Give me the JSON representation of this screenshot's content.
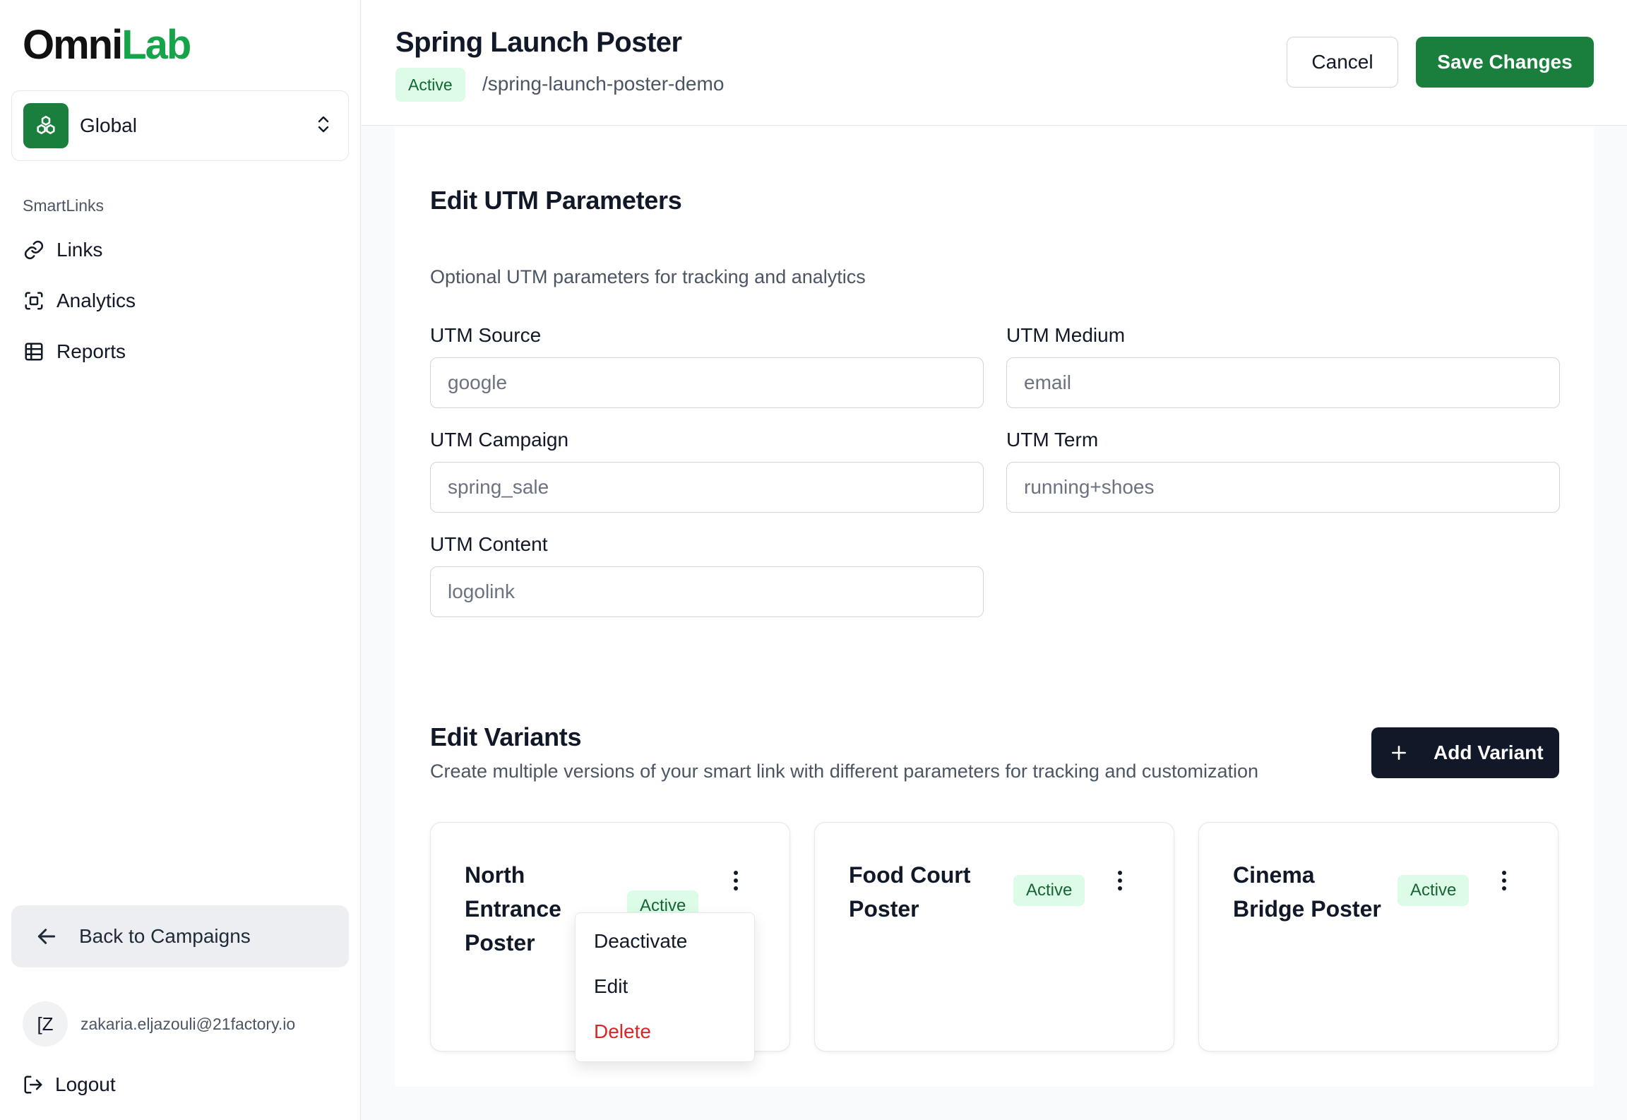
{
  "brand": {
    "logo_part1": "Omni",
    "logo_part2": "Lab",
    "accent": "#16a34a",
    "primary": "#1a7f3c"
  },
  "sidebar": {
    "org": {
      "name": "Global",
      "icon": "cluster-icon"
    },
    "section_label": "SmartLinks",
    "items": [
      {
        "label": "Links",
        "icon": "link-icon"
      },
      {
        "label": "Analytics",
        "icon": "scan-icon"
      },
      {
        "label": "Reports",
        "icon": "table-icon"
      }
    ],
    "back_label": "Back to Campaigns",
    "user": {
      "initials": "[Z",
      "email": "zakaria.eljazouli@21factory.io"
    },
    "logout_label": "Logout"
  },
  "header": {
    "title": "Spring Launch Poster",
    "status": "Active",
    "slug": "/spring-launch-poster-demo",
    "cancel_label": "Cancel",
    "save_label": "Save Changes"
  },
  "utm": {
    "title": "Edit UTM Parameters",
    "description": "Optional UTM parameters for tracking and analytics",
    "fields": [
      {
        "label": "UTM Source",
        "placeholder": "google",
        "value": ""
      },
      {
        "label": "UTM Medium",
        "placeholder": "email",
        "value": ""
      },
      {
        "label": "UTM Campaign",
        "placeholder": "spring_sale",
        "value": ""
      },
      {
        "label": "UTM Term",
        "placeholder": "running+shoes",
        "value": ""
      },
      {
        "label": "UTM Content",
        "placeholder": "logolink",
        "value": ""
      }
    ]
  },
  "variants": {
    "title": "Edit Variants",
    "description": "Create multiple versions of your smart link with different parameters for tracking and customization",
    "add_label": "Add Variant",
    "cards": [
      {
        "name_lines": [
          "North",
          "Entrance",
          "Poster"
        ],
        "status": "Active"
      },
      {
        "name_lines": [
          "Food Court",
          "Poster"
        ],
        "status": "Active"
      },
      {
        "name_lines": [
          "Cinema",
          "Bridge Poster"
        ],
        "status": "Active"
      }
    ],
    "menu": {
      "deactivate": "Deactivate",
      "edit": "Edit",
      "delete": "Delete"
    }
  }
}
